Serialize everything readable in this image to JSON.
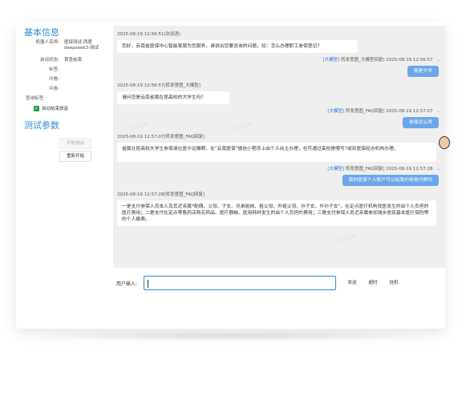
{
  "sidebar": {
    "basic_title": "基本信息",
    "robot_name_label": "机器人名称:",
    "robot_name_value": "医保测试-西度deepseek3-测试",
    "status_label": "启动状态:",
    "status_value": "首查结束",
    "label_field": "标签:",
    "question_field": "问卷:",
    "flow_field": "问卷:",
    "query_label": "查询标签:",
    "auto_checkbox_label": "自动结束放音",
    "test_title": "测试参数",
    "start_button": "开始测试",
    "restart_button": "重新开始"
  },
  "chat": {
    "messages": [
      {
        "time": "2025-08-19 12:56:51(欢迎语)",
        "text": "您好，云南省医保中心智能客服为您服务，请说出您要咨询的问题，如：怎么办理职工参保登记?"
      },
      {
        "meta_tag": "[大模型]",
        "meta": "转发意图_大模型回复] 2025-08-19 12:56:57",
        "reply": "我是大学"
      },
      {
        "time": "2025-08-19 12:56:57[转发意图_大模型]",
        "text": "请问您是云南省属在昆高校的大学生吗?"
      },
      {
        "meta_tag": "[大模型]",
        "meta": "转发意图_FAQ回复] 2025-08-19 12:57:07",
        "reply": "参保怎么弄"
      },
      {
        "time": "2025-08-19 12:57:07[转发意图_FAQ回复]",
        "text": "省属在昆高校大学生参保请在医中证缴期，在\"云南医保\"微信小程序上由个人自主办理，也可通过高校是哪写?或到医保经办机构办理。"
      },
      {
        "meta_tag": "[大模型]",
        "meta": "转发意图_FAQ回复] 2025-08-19 12:57:28",
        "reply": "我的医保个人账户可以给我的爸爸付费吗"
      },
      {
        "time": "2025-08-19 12:57:28[转发意图_FAQ回复]",
        "text": "一是支付参保人员本人及其近亲属*配偶、父母、子女、兄弟姐妹、祖父母、外祖父母、孙子女、外孙子女\"，在定点医疗机构就医发生的由个人负担的医疗费用；二是支付在定点零售药店购买药品、医疗器械、医用耗材发生的由个人负担的费用；三是支付参保人员近亲属参加城乡居民基本医疗保险等的个人缴费。"
      }
    ]
  },
  "input": {
    "label": "用户输入:",
    "value": "",
    "send_button": "发送",
    "timeout_button": "超时",
    "hangup_button": "挂机"
  },
  "watermark": "测试水印"
}
